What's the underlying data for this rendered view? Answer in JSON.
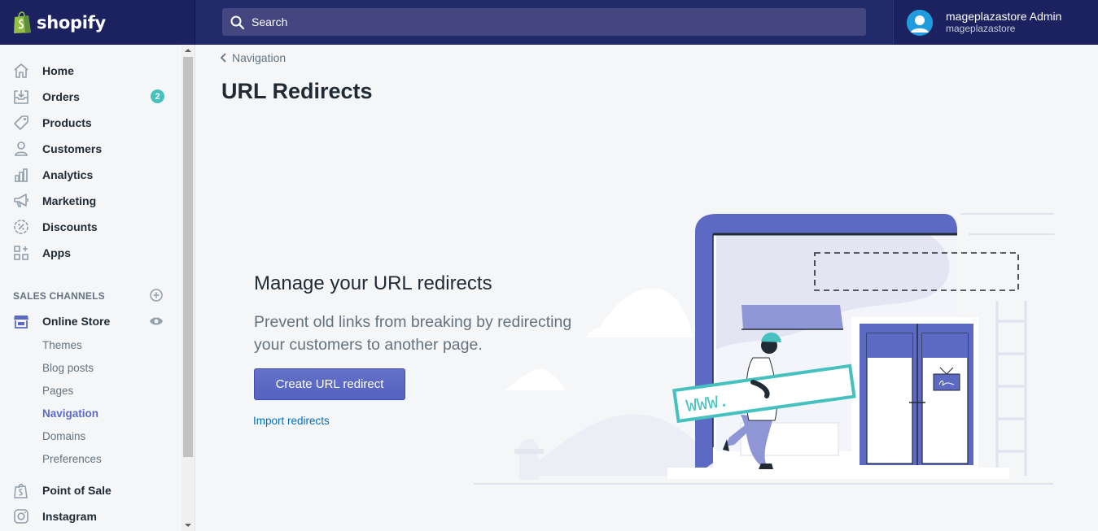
{
  "app": {
    "brand": "shopify"
  },
  "search": {
    "placeholder": "Search"
  },
  "user": {
    "name": "mageplazastore Admin",
    "store": "mageplazastore"
  },
  "sidebar": {
    "items": [
      {
        "label": "Home",
        "icon": "home-icon"
      },
      {
        "label": "Orders",
        "icon": "orders-icon",
        "badge": "2"
      },
      {
        "label": "Products",
        "icon": "tag-icon"
      },
      {
        "label": "Customers",
        "icon": "customer-icon"
      },
      {
        "label": "Analytics",
        "icon": "bar-chart-icon"
      },
      {
        "label": "Marketing",
        "icon": "megaphone-icon"
      },
      {
        "label": "Discounts",
        "icon": "discount-icon"
      },
      {
        "label": "Apps",
        "icon": "apps-icon"
      }
    ],
    "sales_channels_title": "SALES CHANNELS",
    "online_store": {
      "label": "Online Store",
      "sub_items": [
        "Themes",
        "Blog posts",
        "Pages",
        "Navigation",
        "Domains",
        "Preferences"
      ],
      "active": "Navigation"
    },
    "other_channels": [
      {
        "label": "Point of Sale",
        "icon": "shopify-bag-icon"
      },
      {
        "label": "Instagram",
        "icon": "instagram-icon"
      }
    ]
  },
  "breadcrumb": {
    "label": "Navigation"
  },
  "page": {
    "title": "URL Redirects"
  },
  "empty_state": {
    "heading": "Manage your URL redirects",
    "description": "Prevent old links from breaking by redirecting your customers to another page.",
    "primary_action": "Create URL redirect",
    "secondary_action": "Import redirects"
  },
  "illustration": {
    "sign_text": "WWW."
  },
  "colors": {
    "topbar": "#1c2260",
    "accent": "#5c6ac4",
    "badge": "#47c1bf",
    "link": "#006fbb"
  }
}
